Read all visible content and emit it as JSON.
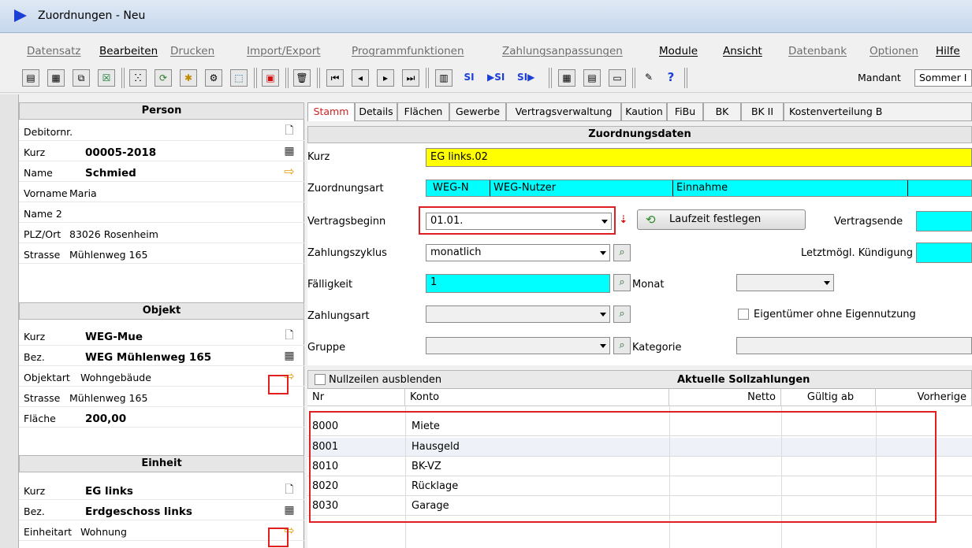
{
  "window": {
    "title": "Zuordnungen - Neu"
  },
  "menu": [
    {
      "label": "Datensatz",
      "enabled": false
    },
    {
      "label": "Bearbeiten",
      "enabled": true
    },
    {
      "label": "Drucken",
      "enabled": false
    },
    {
      "label": "Import/Export",
      "enabled": false
    },
    {
      "label": "Programmfunktionen",
      "enabled": false
    },
    {
      "label": "Zahlungsanpassungen",
      "enabled": false
    },
    {
      "label": "Module",
      "enabled": true
    },
    {
      "label": "Ansicht",
      "enabled": true
    },
    {
      "label": "Datenbank",
      "enabled": false
    },
    {
      "label": "Optionen",
      "enabled": false
    },
    {
      "label": "Hilfe",
      "enabled": true
    }
  ],
  "toolbar": {
    "icons": [
      "printer-icon",
      "print-preview-icon",
      "copy-icon",
      "excel-icon",
      "binoculars-icon",
      "folder-open-icon",
      "new-icon",
      "settings-icon",
      "export-icon",
      "save-icon",
      "delete-icon",
      "first-record-icon",
      "prev-record-icon",
      "next-record-icon",
      "last-record-icon",
      "calendar-icon",
      "si-icon",
      "si-icon",
      "si-icon",
      "calculator-icon",
      "clipboard-icon",
      "print-icon",
      "pencil-icon",
      "help-icon"
    ],
    "mandant_label": "Mandant",
    "mandant_value": "Sommer I"
  },
  "person": {
    "header": "Person",
    "rows": [
      {
        "label": "Debitornr.",
        "value": ""
      },
      {
        "label": "Kurz",
        "value": "00005-2018"
      },
      {
        "label": "Name",
        "value": "Schmied"
      },
      {
        "label": "Vorname",
        "value": "Maria"
      },
      {
        "label": "Name 2",
        "value": ""
      },
      {
        "label": "PLZ/Ort",
        "value": "83026 Rosenheim"
      },
      {
        "label": "Strasse",
        "value": "Mühlenweg 165"
      }
    ]
  },
  "objekt": {
    "header": "Objekt",
    "rows": [
      {
        "label": "Kurz",
        "value": "WEG-Mue"
      },
      {
        "label": "Bez.",
        "value": "WEG Mühlenweg 165"
      },
      {
        "label": "Objektart",
        "value": "Wohngebäude"
      },
      {
        "label": "Strasse",
        "value": "Mühlenweg 165"
      },
      {
        "label": "Fläche",
        "value": "200,00"
      }
    ]
  },
  "einheit": {
    "header": "Einheit",
    "rows": [
      {
        "label": "Kurz",
        "value": "EG links"
      },
      {
        "label": "Bez.",
        "value": "Erdgeschoss links"
      },
      {
        "label": "Einheitart",
        "value": "Wohnung"
      }
    ]
  },
  "tabs": [
    "Stamm",
    "Details",
    "Flächen",
    "Gewerbe",
    "Vertragsverwaltung",
    "Kaution",
    "FiBu",
    "BK",
    "BK II",
    "Kostenverteilung B"
  ],
  "section_header": "Zuordnungsdaten",
  "form": {
    "kurz_label": "Kurz",
    "kurz_value": "EG links.02",
    "art_label": "Zuordnungsart",
    "art_code": "WEG-N",
    "art_name": "WEG-Nutzer",
    "art_type": "Einnahme",
    "beginn_label": "Vertragsbeginn",
    "beginn_value": "01.01.",
    "laufzeit_button": "Laufzeit festlegen",
    "ende_label": "Vertragsende",
    "zyklus_label": "Zahlungszyklus",
    "zyklus_value": "monatlich",
    "kuendigung_label": "Letztmögl. Kündigung",
    "faelligkeit_label": "Fälligkeit",
    "faelligkeit_value": "1",
    "monat_label": "Monat",
    "zahlungsart_label": "Zahlungsart",
    "eigentuemer_label": "Eigentümer ohne Eigennutzung",
    "gruppe_label": "Gruppe",
    "kategorie_label": "Kategorie"
  },
  "grid": {
    "nullzeilen_label": "Nullzeilen ausblenden",
    "title": "Aktuelle Sollzahlungen",
    "columns": [
      "Nr",
      "Konto",
      "Netto",
      "Gültig ab",
      "Vorherige"
    ],
    "rows": [
      {
        "nr": "8000",
        "konto": "Miete"
      },
      {
        "nr": "8001",
        "konto": "Hausgeld"
      },
      {
        "nr": "8010",
        "konto": "BK-VZ"
      },
      {
        "nr": "8020",
        "konto": "Rücklage"
      },
      {
        "nr": "8030",
        "konto": "Garage"
      }
    ]
  }
}
